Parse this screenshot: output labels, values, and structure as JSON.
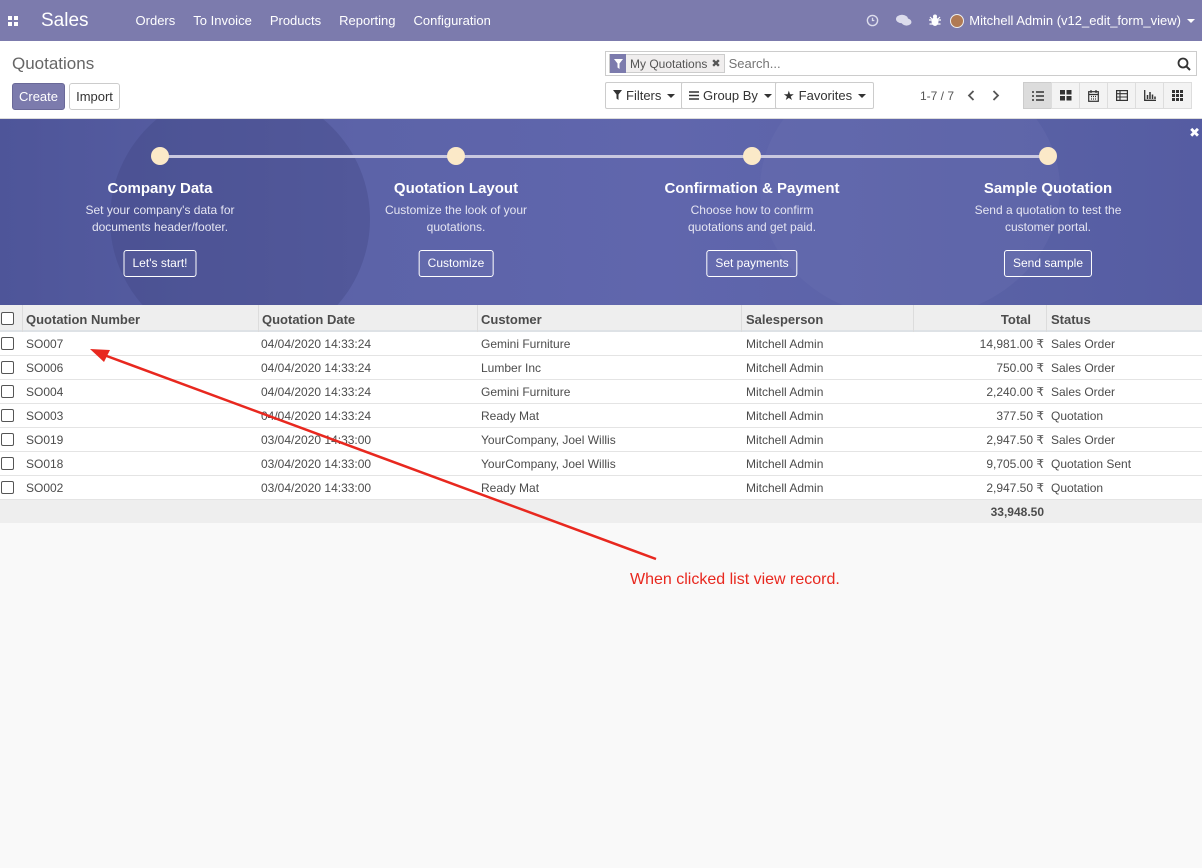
{
  "nav": {
    "app_name": "Sales",
    "menu": [
      "Orders",
      "To Invoice",
      "Products",
      "Reporting",
      "Configuration"
    ],
    "user": "Mitchell Admin (v12_edit_form_view)"
  },
  "control_panel": {
    "breadcrumb": "Quotations",
    "create_label": "Create",
    "import_label": "Import",
    "facet_label": "My Quotations",
    "search_placeholder": "Search...",
    "filters_label": "Filters",
    "groupby_label": "Group By",
    "favorites_label": "Favorites",
    "pager": "1-7 / 7"
  },
  "banner": {
    "steps": [
      {
        "title": "Company Data",
        "desc": "Set your company's data for documents header/footer.",
        "button": "Let's start!"
      },
      {
        "title": "Quotation Layout",
        "desc": "Customize the look of your quotations.",
        "button": "Customize"
      },
      {
        "title": "Confirmation & Payment",
        "desc": "Choose how to confirm quotations and get paid.",
        "button": "Set payments"
      },
      {
        "title": "Sample Quotation",
        "desc": "Send a quotation to test the customer portal.",
        "button": "Send sample"
      }
    ],
    "colors": {
      "dot": "#fbe9c8",
      "background": "#5c63a8"
    }
  },
  "table": {
    "headers": [
      "Quotation Number",
      "Quotation Date",
      "Customer",
      "Salesperson",
      "Total",
      "Status"
    ],
    "rows": [
      [
        "SO007",
        "04/04/2020 14:33:24",
        "Gemini Furniture",
        "Mitchell Admin",
        "14,981.00 ₹",
        "Sales Order"
      ],
      [
        "SO006",
        "04/04/2020 14:33:24",
        "Lumber Inc",
        "Mitchell Admin",
        "750.00 ₹",
        "Sales Order"
      ],
      [
        "SO004",
        "04/04/2020 14:33:24",
        "Gemini Furniture",
        "Mitchell Admin",
        "2,240.00 ₹",
        "Sales Order"
      ],
      [
        "SO003",
        "04/04/2020 14:33:24",
        "Ready Mat",
        "Mitchell Admin",
        "377.50 ₹",
        "Quotation"
      ],
      [
        "SO019",
        "03/04/2020 14:33:00",
        "YourCompany, Joel Willis",
        "Mitchell Admin",
        "2,947.50 ₹",
        "Sales Order"
      ],
      [
        "SO018",
        "03/04/2020 14:33:00",
        "YourCompany, Joel Willis",
        "Mitchell Admin",
        "9,705.00 ₹",
        "Quotation Sent"
      ],
      [
        "SO002",
        "03/04/2020 14:33:00",
        "Ready Mat",
        "Mitchell Admin",
        "2,947.50 ₹",
        "Quotation"
      ]
    ],
    "total": "33,948.50"
  },
  "annotation": {
    "text": "When clicked list view record.",
    "color": "#e8281f"
  },
  "theme": {
    "primary": "#7c7bad"
  }
}
